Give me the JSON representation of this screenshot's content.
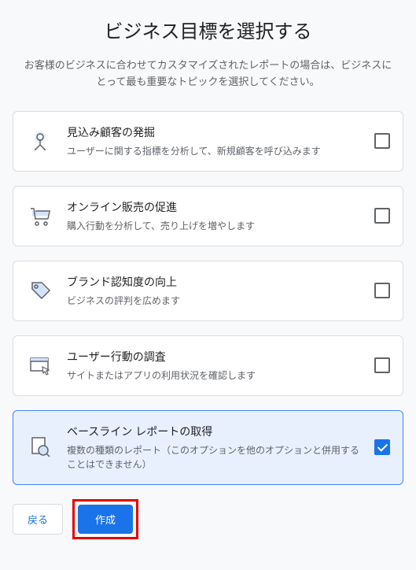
{
  "title": "ビジネス目標を選択する",
  "subtitle": "お客様のビジネスに合わせてカスタマイズされたレポートの場合は、ビジネスにとって最も重要なトピックを選択してください。",
  "options": [
    {
      "title": "見込み顧客の発掘",
      "desc": "ユーザーに関する指標を分析して、新規顧客を呼び込みます"
    },
    {
      "title": "オンライン販売の促進",
      "desc": "購入行動を分析して、売り上げを増やします"
    },
    {
      "title": "ブランド認知度の向上",
      "desc": "ビジネスの評判を広めます"
    },
    {
      "title": "ユーザー行動の調査",
      "desc": "サイトまたはアプリの利用状況を確認します"
    },
    {
      "title": "ベースライン レポートの取得",
      "desc": "複数の種類のレポート（このオプションを他のオプションと併用することはできません）"
    }
  ],
  "buttons": {
    "back": "戻る",
    "create": "作成"
  }
}
